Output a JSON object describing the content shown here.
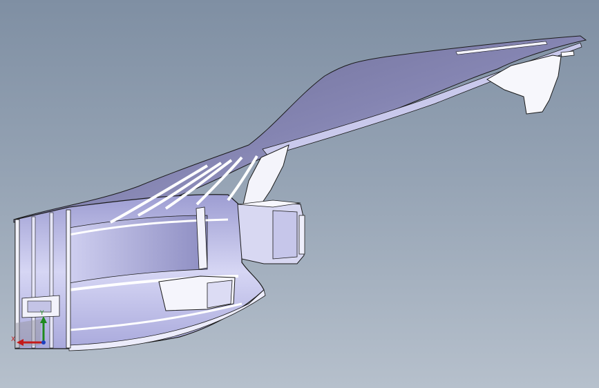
{
  "viewport": {
    "background_top": "#7f8fa3",
    "background_bottom": "#b6c0cc"
  },
  "model": {
    "icon": "cad-part-3d",
    "shaded_color": "#b9b9ea",
    "edge_color": "#1a1a1a",
    "highlight_color": "#ffffff"
  },
  "triad": {
    "y_label": "Y",
    "x_label": "X",
    "y_color": "#1e8a1e",
    "x_color": "#c41a1a",
    "z_color": "#1d3fbf"
  }
}
